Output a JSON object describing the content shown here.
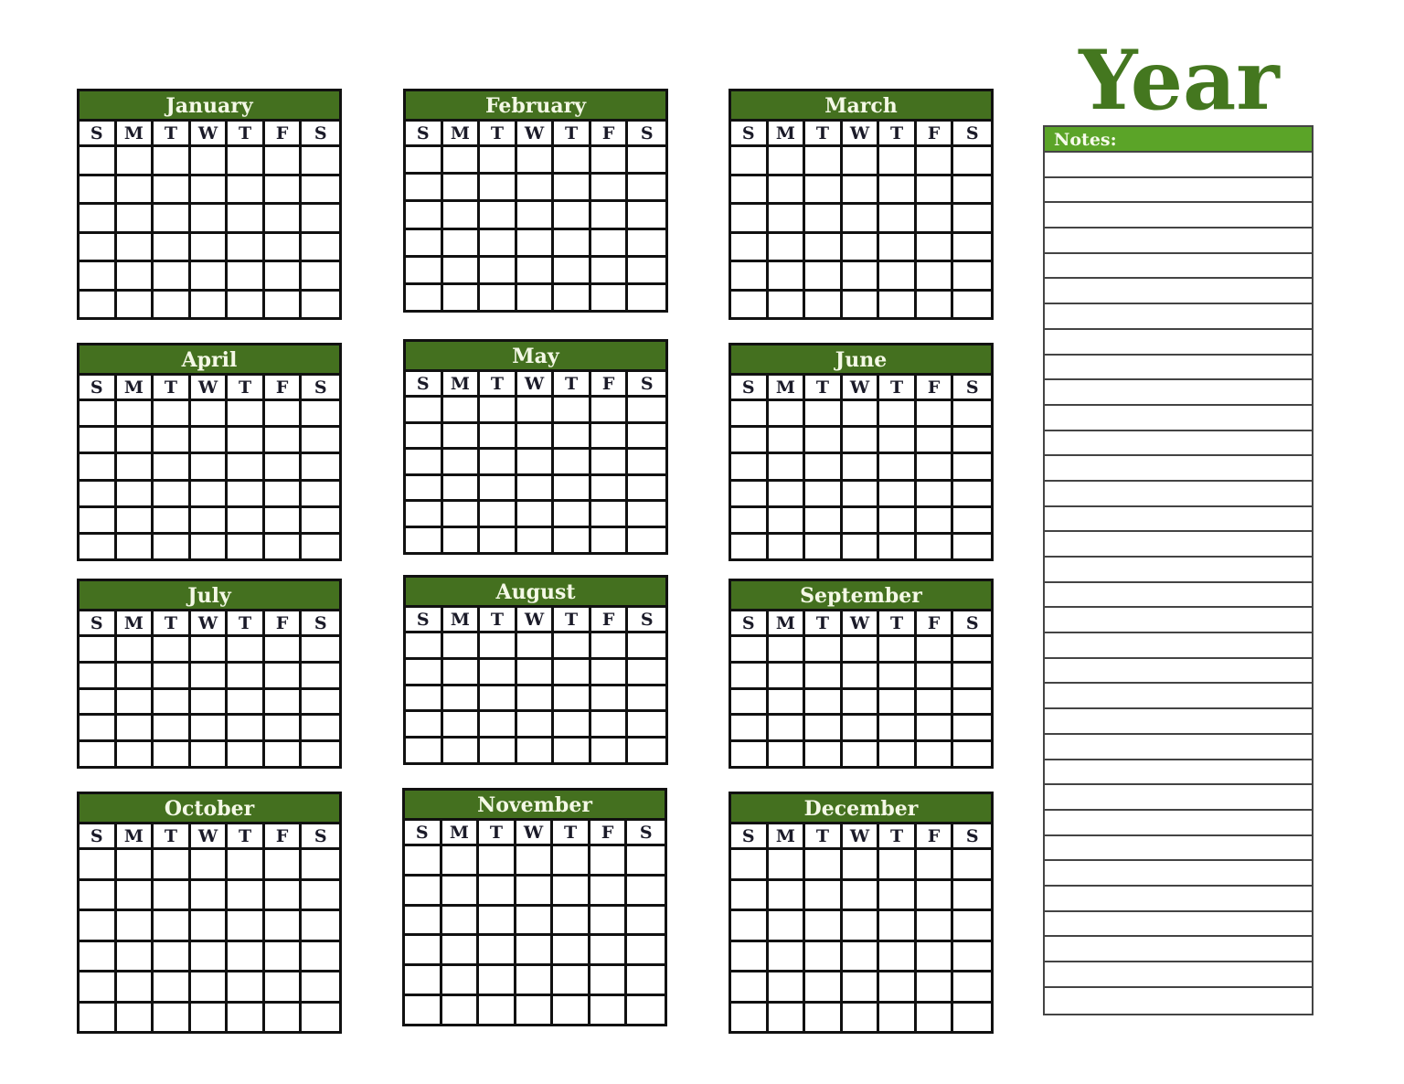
{
  "title": "Year",
  "notes": {
    "label": "Notes:",
    "line_count": 34
  },
  "weekday_headers": [
    "S",
    "M",
    "T",
    "W",
    "T",
    "F",
    "S"
  ],
  "colors": {
    "month_header": "#44701f",
    "notes_header": "#5ba428",
    "title": "#44771f",
    "grid_line": "#111111"
  },
  "months": [
    {
      "name": "January",
      "week_rows": 6
    },
    {
      "name": "February",
      "week_rows": 6
    },
    {
      "name": "March",
      "week_rows": 6
    },
    {
      "name": "April",
      "week_rows": 6
    },
    {
      "name": "May",
      "week_rows": 6
    },
    {
      "name": "June",
      "week_rows": 6
    },
    {
      "name": "July",
      "week_rows": 5
    },
    {
      "name": "August",
      "week_rows": 5
    },
    {
      "name": "September",
      "week_rows": 5
    },
    {
      "name": "October",
      "week_rows": 6
    },
    {
      "name": "November",
      "week_rows": 6
    },
    {
      "name": "December",
      "week_rows": 6
    }
  ]
}
